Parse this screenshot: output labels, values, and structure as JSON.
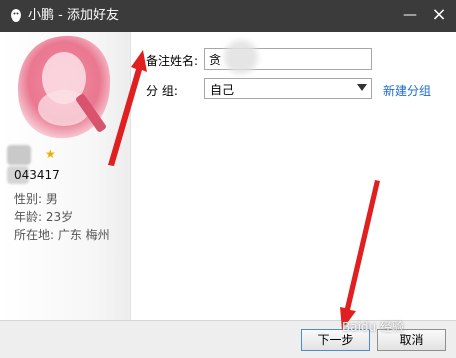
{
  "window": {
    "title": "小鹏 - 添加好友",
    "minimize_symbol": "—",
    "close_symbol": "×"
  },
  "profile": {
    "qq_number_visible": "043417",
    "gender": "性别: 男",
    "age": "年龄: 23岁",
    "location": "所在地: 广东  梅州",
    "star_icon": "★"
  },
  "form": {
    "remark_label": "备注姓名:",
    "remark_value": "贪",
    "group_label": "分  组:",
    "group_value": "自己",
    "new_group_link": "新建分组"
  },
  "buttons": {
    "next": "下一步",
    "cancel": "取消"
  },
  "watermark": "Baidu 经验",
  "colors": {
    "titlebar": "#3b3b3b",
    "link": "#1c6ad3",
    "arrow": "#e02020"
  }
}
